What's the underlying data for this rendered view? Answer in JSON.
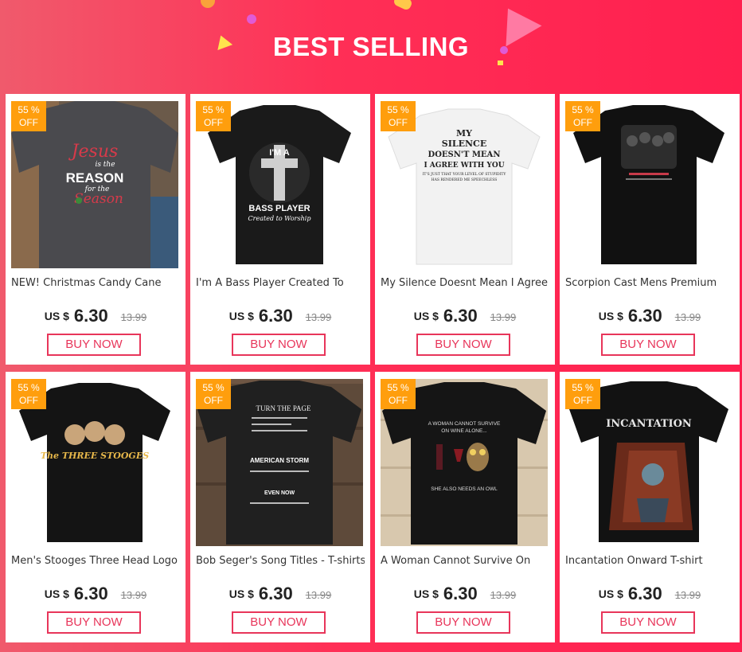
{
  "banner": {
    "title": "BEST SELLING"
  },
  "products": [
    {
      "badge_pct": "55 %",
      "badge_off": "OFF",
      "name": "NEW! Christmas Candy Cane",
      "currency": "US $",
      "price": "6.30",
      "old_price": "13.99",
      "buy": "BUY NOW",
      "art": [
        "Jesus",
        "is the",
        "REASON",
        "for the",
        "Season"
      ]
    },
    {
      "badge_pct": "55 %",
      "badge_off": "OFF",
      "name": "I'm A Bass Player Created To",
      "currency": "US $",
      "price": "6.30",
      "old_price": "13.99",
      "buy": "BUY NOW",
      "art": [
        "I'M A",
        "BASS PLAYER",
        "Created to Worship"
      ]
    },
    {
      "badge_pct": "55 %",
      "badge_off": "OFF",
      "name": "My Silence Doesnt Mean I Agree",
      "currency": "US $",
      "price": "6.30",
      "old_price": "13.99",
      "buy": "BUY NOW",
      "art": [
        "MY",
        "SILENCE",
        "DOESN'T MEAN",
        "I AGREE WITH YOU",
        "IT'S JUST THAT YOUR LEVEL OF STUPIDITY",
        "HAS RENDERED ME SPEECHLESS"
      ]
    },
    {
      "badge_pct": "55 %",
      "badge_off": "OFF",
      "name": "Scorpion Cast Mens Premium",
      "currency": "US $",
      "price": "6.30",
      "old_price": "13.99",
      "buy": "BUY NOW",
      "art": []
    },
    {
      "badge_pct": "55 %",
      "badge_off": "OFF",
      "name": "Men's Stooges Three Head Logo",
      "currency": "US $",
      "price": "6.30",
      "old_price": "13.99",
      "buy": "BUY NOW",
      "art": [
        "The THREE STOOGES"
      ]
    },
    {
      "badge_pct": "55 %",
      "badge_off": "OFF",
      "name": "Bob Seger's Song Titles - T-shirts",
      "currency": "US $",
      "price": "6.30",
      "old_price": "13.99",
      "buy": "BUY NOW",
      "art": [
        "TURN THE PAGE",
        "AMERICAN STORM",
        "EVEN NOW"
      ]
    },
    {
      "badge_pct": "55 %",
      "badge_off": "OFF",
      "name": "A Woman Cannot Survive On",
      "currency": "US $",
      "price": "6.30",
      "old_price": "13.99",
      "buy": "BUY NOW",
      "art": [
        "A WOMAN CANNOT SURVIVE",
        "ON WINE ALONE...",
        "SHE ALSO NEEDS AN OWL"
      ]
    },
    {
      "badge_pct": "55 %",
      "badge_off": "OFF",
      "name": "Incantation Onward T-shirt",
      "currency": "US $",
      "price": "6.30",
      "old_price": "13.99",
      "buy": "BUY NOW",
      "art": [
        "INCANTATION"
      ]
    }
  ],
  "colors": {
    "accent": "#e8355a",
    "badge": "#ff9e0d",
    "banner": "#ff2f56"
  }
}
